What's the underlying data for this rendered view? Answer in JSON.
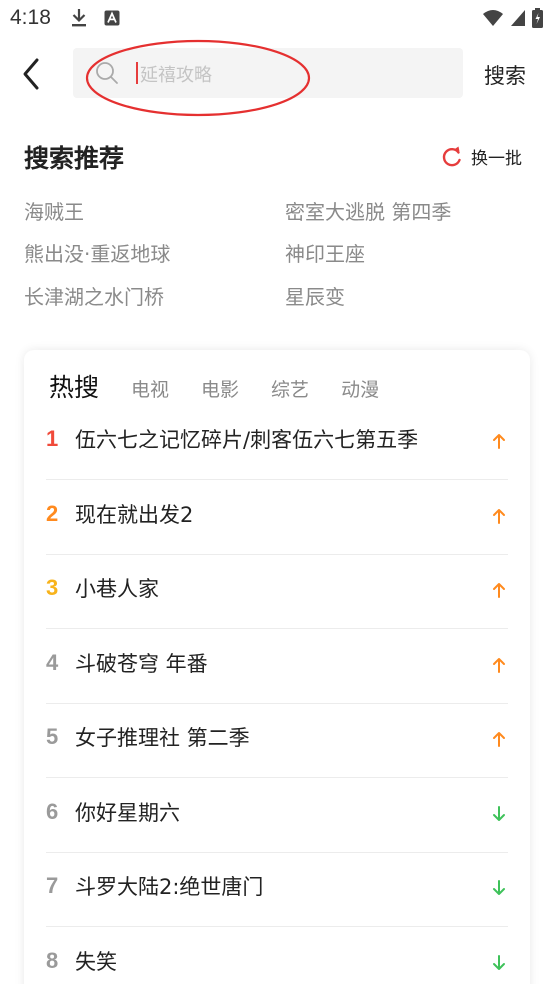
{
  "status": {
    "time": "4:18"
  },
  "search": {
    "placeholder": "延禧攻略",
    "button_label": "搜索"
  },
  "recommend": {
    "title": "搜索推荐",
    "refresh_label": "换一批",
    "items": [
      "海贼王",
      "密室大逃脱 第四季",
      "熊出没·重返地球",
      "神印王座",
      "长津湖之水门桥",
      "星辰变"
    ]
  },
  "hot": {
    "tabs": [
      "热搜",
      "电视",
      "电影",
      "综艺",
      "动漫"
    ],
    "items": [
      {
        "rank": "1",
        "title": "伍六七之记忆碎片/刺客伍六七第五季",
        "trend": "up",
        "rank_color": "#f04a3a"
      },
      {
        "rank": "2",
        "title": "现在就出发2",
        "trend": "up",
        "rank_color": "#ff8a1e"
      },
      {
        "rank": "3",
        "title": "小巷人家",
        "trend": "up",
        "rank_color": "#f8b31b"
      },
      {
        "rank": "4",
        "title": "斗破苍穹 年番",
        "trend": "up",
        "rank_color": "#9a9a9a"
      },
      {
        "rank": "5",
        "title": "女子推理社 第二季",
        "trend": "up",
        "rank_color": "#9a9a9a"
      },
      {
        "rank": "6",
        "title": "你好星期六",
        "trend": "down",
        "rank_color": "#9a9a9a"
      },
      {
        "rank": "7",
        "title": "斗罗大陆2:绝世唐门",
        "trend": "down",
        "rank_color": "#9a9a9a"
      },
      {
        "rank": "8",
        "title": "失笑",
        "trend": "down",
        "rank_color": "#9a9a9a"
      }
    ]
  },
  "colors": {
    "trend_up": "#ff8a1e",
    "trend_down": "#3ec25a",
    "refresh_icon": "#e63d3d",
    "annotation": "#e53030"
  },
  "icons": [
    "back-arrow-icon",
    "search-icon",
    "refresh-icon",
    "trend-up-icon",
    "trend-down-icon",
    "download-icon",
    "wifi-icon",
    "signal-icon",
    "battery-icon"
  ]
}
